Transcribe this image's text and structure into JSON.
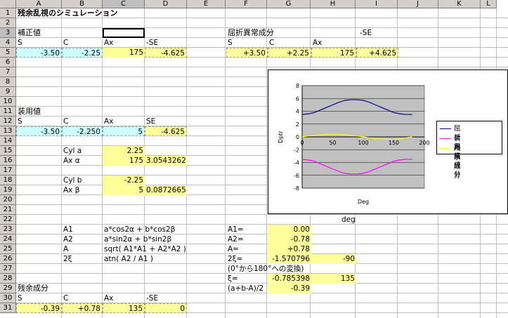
{
  "columns": [
    "A",
    "B",
    "C",
    "D",
    "E",
    "F",
    "G",
    "H",
    "I",
    "J",
    "K",
    "L"
  ],
  "rows": [
    "1",
    "2",
    "3",
    "4",
    "5",
    "6",
    "7",
    "8",
    "9",
    "10",
    "11",
    "12",
    "13",
    "14",
    "15",
    "16",
    "17",
    "18",
    "19",
    "20",
    "21",
    "22",
    "23",
    "24",
    "25",
    "26",
    "27",
    "28",
    "29",
    "30",
    "31"
  ],
  "cells": {
    "a1": "残余乱視のシミュレーション",
    "a3": "補正値",
    "a4_s": "S",
    "a4_c": "C",
    "a4_ax": "Ax",
    "a4_se": "-SE",
    "a5_s": "-3.50",
    "a5_c": "-2.25",
    "a5_ax": "175",
    "a5_se": "-4.625",
    "f3": "屈折異常成分",
    "i3": "-SE",
    "f4_s": "S",
    "f4_c": "C",
    "f4_ax": "Ax",
    "f5_s": "+3.50",
    "f5_c": "+2.25",
    "f5_ax": "175",
    "f5_se": "+4.625",
    "a11": "装用値",
    "a12_s": "S",
    "a12_c": "C",
    "a12_ax": "Ax",
    "a12_se": "SE",
    "a13_s": "-3.50",
    "a13_c": "-2.250",
    "a13_ax": "5",
    "a13_se": "-4.625",
    "b15": "Cyl a",
    "c15": "2.25",
    "b16": "Ax α",
    "c16": "175",
    "d16": "3.0543262",
    "b18": "Cyl b",
    "c18": "-2.25",
    "b19": "Ax β",
    "c19": "5",
    "d19": "0.0872665",
    "h22": "deg",
    "b23": "A1",
    "c23": "a*cos2α + b*cos2β",
    "f23": "A1=",
    "g23": "0.00",
    "b24": "A2",
    "c24": "a*sin2α + b*sin2β",
    "f24": "A2=",
    "g24": "-0.78",
    "b25": "A",
    "c25": "sqrt( A1*A1 + A2*A2 )",
    "f25": "A=",
    "g25": "+0.78",
    "b26": "2ξ",
    "c26": "atn( A2 / A1 )",
    "f26": "2ξ=",
    "g26": "-1.570796",
    "h26": "-90",
    "f27": "(0°から180°への変換)",
    "f28": "ξ=",
    "g28": "-0.785398",
    "h28": "135",
    "f29": "(a+b-A)/2",
    "g29": "-0.39",
    "a29": "残余成分",
    "a30_s": "S",
    "a30_c": "C",
    "a30_ax": "Ax",
    "a30_se": "-SE",
    "a31_s": "-0.39",
    "a31_c": "+0.78",
    "a31_ax": "135",
    "a31_se": "0"
  },
  "chart_data": {
    "type": "line",
    "xlabel": "Deg",
    "ylabel": "Dptr",
    "xlim": [
      0,
      200
    ],
    "ylim": [
      -8,
      8
    ],
    "xticks": [
      0,
      50,
      100,
      150,
      200
    ],
    "yticks": [
      8,
      6,
      4,
      2,
      0,
      -2,
      -4,
      -6,
      -8
    ],
    "grid": true,
    "legend_position": "right",
    "series": [
      {
        "name": "屈折異常成分",
        "color": "#000080",
        "x": [
          0,
          10,
          20,
          30,
          40,
          50,
          60,
          70,
          80,
          90,
          100,
          110,
          120,
          130,
          140,
          150,
          160,
          170,
          180
        ],
        "values": [
          3.5,
          3.6,
          3.8,
          4.2,
          4.6,
          5.0,
          5.4,
          5.7,
          5.8,
          5.8,
          5.7,
          5.4,
          5.0,
          4.6,
          4.2,
          3.8,
          3.6,
          3.5,
          3.5
        ]
      },
      {
        "name": "装用成分",
        "color": "#ff00ff",
        "x": [
          0,
          10,
          20,
          30,
          40,
          50,
          60,
          70,
          80,
          90,
          100,
          110,
          120,
          130,
          140,
          150,
          160,
          170,
          180
        ],
        "values": [
          -3.5,
          -3.6,
          -3.8,
          -4.2,
          -4.6,
          -5.0,
          -5.4,
          -5.7,
          -5.8,
          -5.8,
          -5.7,
          -5.4,
          -5.0,
          -4.6,
          -4.2,
          -3.8,
          -3.6,
          -3.5,
          -3.5
        ]
      },
      {
        "name": "残余成分",
        "color": "#ffff00",
        "x": [
          0,
          10,
          20,
          30,
          40,
          50,
          60,
          70,
          80,
          90,
          100,
          110,
          120,
          130,
          140,
          150,
          160,
          170,
          180
        ],
        "values": [
          0,
          0.13,
          0.25,
          0.33,
          0.38,
          0.39,
          0.38,
          0.33,
          0.25,
          0.13,
          0,
          -0.13,
          -0.25,
          -0.33,
          -0.38,
          -0.39,
          -0.33,
          -0.13,
          0
        ]
      }
    ]
  }
}
